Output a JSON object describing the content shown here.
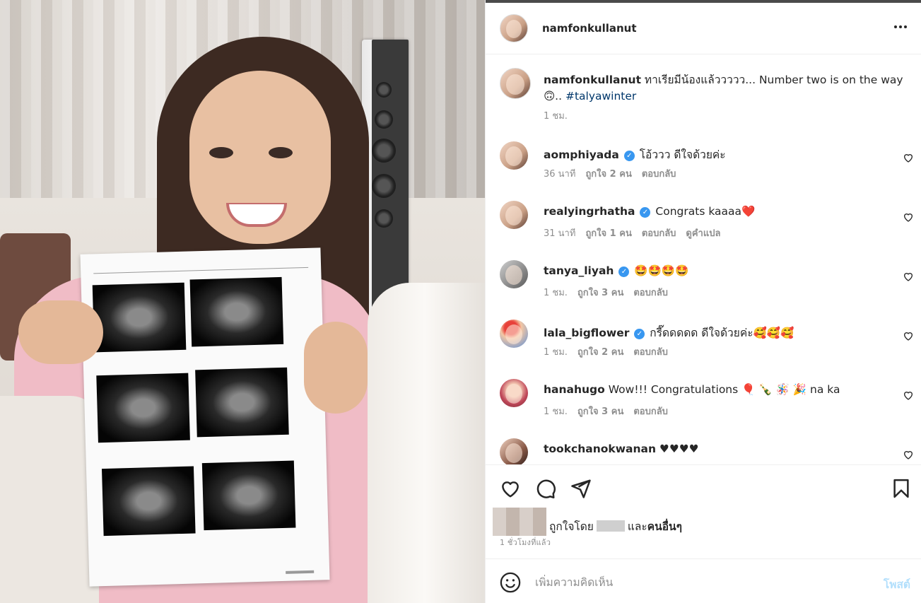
{
  "post": {
    "username": "namfonkullanut",
    "more_icon": "more-horizontal-icon"
  },
  "caption": {
    "username": "namfonkullanut",
    "text": " ทาเรียมีน้องแล้ววววว... Number two is on the way 🙃.. ",
    "hashtag": "#talyawinter",
    "time": "1 ชม."
  },
  "comments": [
    {
      "username": "aomphiyada",
      "verified": true,
      "text": " โอ้ววว ดีใจด้วยค่ะ",
      "time": "36 นาที",
      "likes": "ถูกใจ 2 คน",
      "reply": "ตอบกลับ",
      "translate": ""
    },
    {
      "username": "realyingrhatha",
      "verified": true,
      "text": " Congrats kaaaa❤️",
      "time": "31 นาที",
      "likes": "ถูกใจ 1 คน",
      "reply": "ตอบกลับ",
      "translate": "ดูคำแปล"
    },
    {
      "username": "tanya_liyah",
      "verified": true,
      "text": " 🤩🤩🤩🤩",
      "time": "1 ชม.",
      "likes": "ถูกใจ 3 คน",
      "reply": "ตอบกลับ",
      "translate": ""
    },
    {
      "username": "lala_bigflower",
      "verified": true,
      "text": " กรี๊ดดดดด ดีใจด้วยค่ะ🥰🥰🥰",
      "time": "1 ชม.",
      "likes": "ถูกใจ 2 คน",
      "reply": "ตอบกลับ",
      "translate": ""
    },
    {
      "username": "hanahugo",
      "verified": false,
      "text": " Wow!!! Congratulations 🎈 🍾 🪅 🎉 na ka",
      "time": "1 ชม.",
      "likes": "ถูกใจ 3 คน",
      "reply": "ตอบกลับ",
      "translate": ""
    },
    {
      "username": "tookchanokwanan",
      "verified": false,
      "text": " ♥♥♥♥",
      "time": "",
      "likes": "",
      "reply": "",
      "translate": ""
    }
  ],
  "actions": {
    "like_icon": "heart-icon",
    "comment_icon": "comment-icon",
    "share_icon": "share-icon",
    "save_icon": "bookmark-icon"
  },
  "likes": {
    "prefix": "ถูกใจโดย",
    "conjunction": "และ",
    "others": "คนอื่นๆ"
  },
  "time_ago": "1 ชั่วโมงที่แล้ว",
  "composer": {
    "emoji_icon": "emoji-icon",
    "placeholder": "เพิ่มความคิดเห็น",
    "post_label": "โพสต์"
  },
  "colors": {
    "link": "#00376b",
    "verified": "#3897f0",
    "post_disabled": "#b2dffc",
    "muted": "#8e8e8e"
  }
}
